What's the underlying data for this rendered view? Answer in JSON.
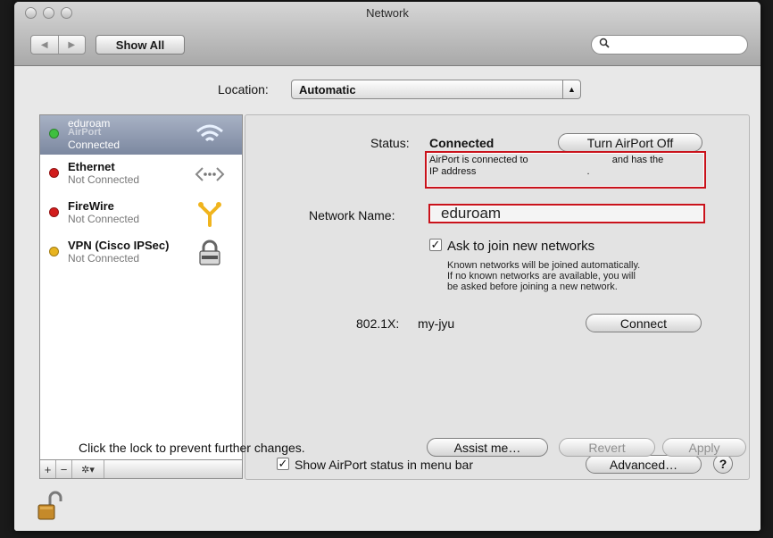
{
  "window": {
    "title": "Network"
  },
  "toolbar": {
    "show_all": "Show All",
    "search_placeholder": ""
  },
  "location": {
    "label": "Location:",
    "value": "Automatic"
  },
  "services": [
    {
      "name": "AirPort",
      "name_overlay": "eduroam",
      "status": "Connected",
      "dot": "#3fbf3f",
      "icon": "wifi-icon"
    },
    {
      "name": "Ethernet",
      "status": "Not Connected",
      "dot": "#d21c1c",
      "icon": "ethernet-icon"
    },
    {
      "name": "FireWire",
      "status": "Not Connected",
      "dot": "#d21c1c",
      "icon": "firewire-icon"
    },
    {
      "name": "VPN (Cisco IPSec)",
      "status": "Not Connected",
      "dot": "#e8b420",
      "icon": "padlock-icon"
    }
  ],
  "sidebar_tools": {
    "add": "+",
    "remove": "−",
    "gear": "✲▾"
  },
  "detail": {
    "status_label": "Status:",
    "status_value": "Connected",
    "turn_off": "Turn AirPort Off",
    "info_line1a": "AirPort is connected to",
    "info_line1b": "and has the",
    "info_line2": "IP address",
    "info_line2_end": ".",
    "network_name_label": "Network Name:",
    "network_name_value": "eduroam",
    "ask_join_label": "Ask to join new networks",
    "ask_join_desc1": "Known networks will be joined automatically.",
    "ask_join_desc2": "If no known networks are available, you will",
    "ask_join_desc3": "be asked before joining a new network.",
    "dot1x_label": "802.1X:",
    "dot1x_value": "my-jyu",
    "connect": "Connect",
    "show_status_label": "Show AirPort status in menu bar",
    "advanced": "Advanced…",
    "help": "?"
  },
  "footer": {
    "lock_text": "Click the lock to prevent further changes.",
    "assist": "Assist me…",
    "revert": "Revert",
    "apply": "Apply"
  },
  "colors": {
    "highlight_red": "#c9121b",
    "selection": "#8893aa"
  }
}
